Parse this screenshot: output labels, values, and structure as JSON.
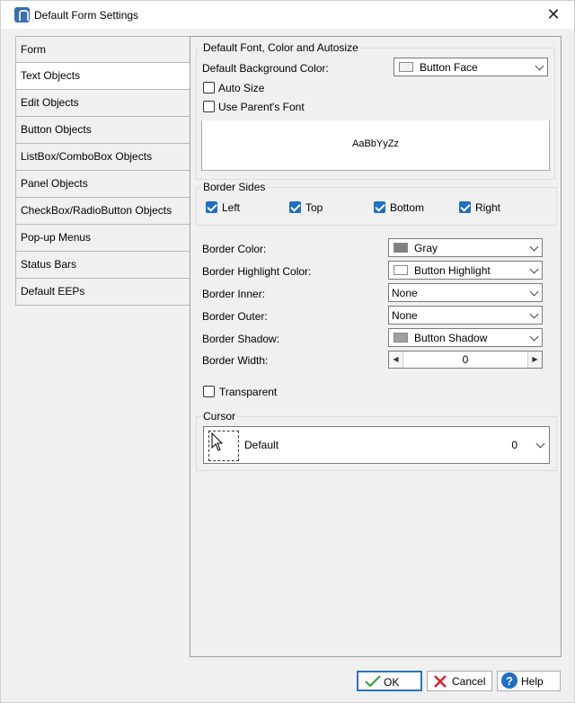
{
  "window": {
    "title": "Default Form Settings",
    "close_glyph": "✕"
  },
  "tabs": [
    {
      "label": "Form"
    },
    {
      "label": "Text Objects"
    },
    {
      "label": "Edit Objects"
    },
    {
      "label": "Button Objects"
    },
    {
      "label": "ListBox/ComboBox Objects"
    },
    {
      "label": "Panel Objects"
    },
    {
      "label": "CheckBox/RadioButton Objects"
    },
    {
      "label": "Pop-up Menus"
    },
    {
      "label": "Status Bars"
    },
    {
      "label": "Default EEPs"
    }
  ],
  "selected_tab": "Text Objects",
  "font_group": {
    "title": "Default Font, Color and Autosize",
    "bg_color_label": "Default Background Color:",
    "bg_color_value": "Button Face",
    "bg_color_swatch": "#f0f0f0",
    "auto_size_label": "Auto Size",
    "auto_size_checked": false,
    "parent_font_label": "Use Parent's Font",
    "parent_font_checked": false,
    "preview_text": "AaBbYyZz"
  },
  "border_sides": {
    "title": "Border Sides",
    "left": {
      "label": "Left",
      "checked": true
    },
    "top": {
      "label": "Top",
      "checked": true
    },
    "bottom": {
      "label": "Bottom",
      "checked": true
    },
    "right": {
      "label": "Right",
      "checked": true
    }
  },
  "border": {
    "color_label": "Border Color:",
    "color_value": "Gray",
    "color_swatch": "#808080",
    "highlight_label": "Border Highlight Color:",
    "highlight_value": "Button Highlight",
    "highlight_swatch": "#ffffff",
    "inner_label": "Border Inner:",
    "inner_value": "None",
    "outer_label": "Border Outer:",
    "outer_value": "None",
    "shadow_label": "Border Shadow:",
    "shadow_value": "Button Shadow",
    "shadow_swatch": "#a0a0a0",
    "width_label": "Border Width:",
    "width_value": "0"
  },
  "transparent": {
    "label": "Transparent",
    "checked": false
  },
  "cursor": {
    "title": "Cursor",
    "value": "Default",
    "number": "0"
  },
  "buttons": {
    "ok": "OK",
    "cancel": "Cancel",
    "help": "Help"
  },
  "colors": {
    "accent": "#1f6fc5",
    "ok_icon": "#2e9e3a",
    "cancel_icon": "#d9232e",
    "help_icon": "#1f6fc5"
  }
}
